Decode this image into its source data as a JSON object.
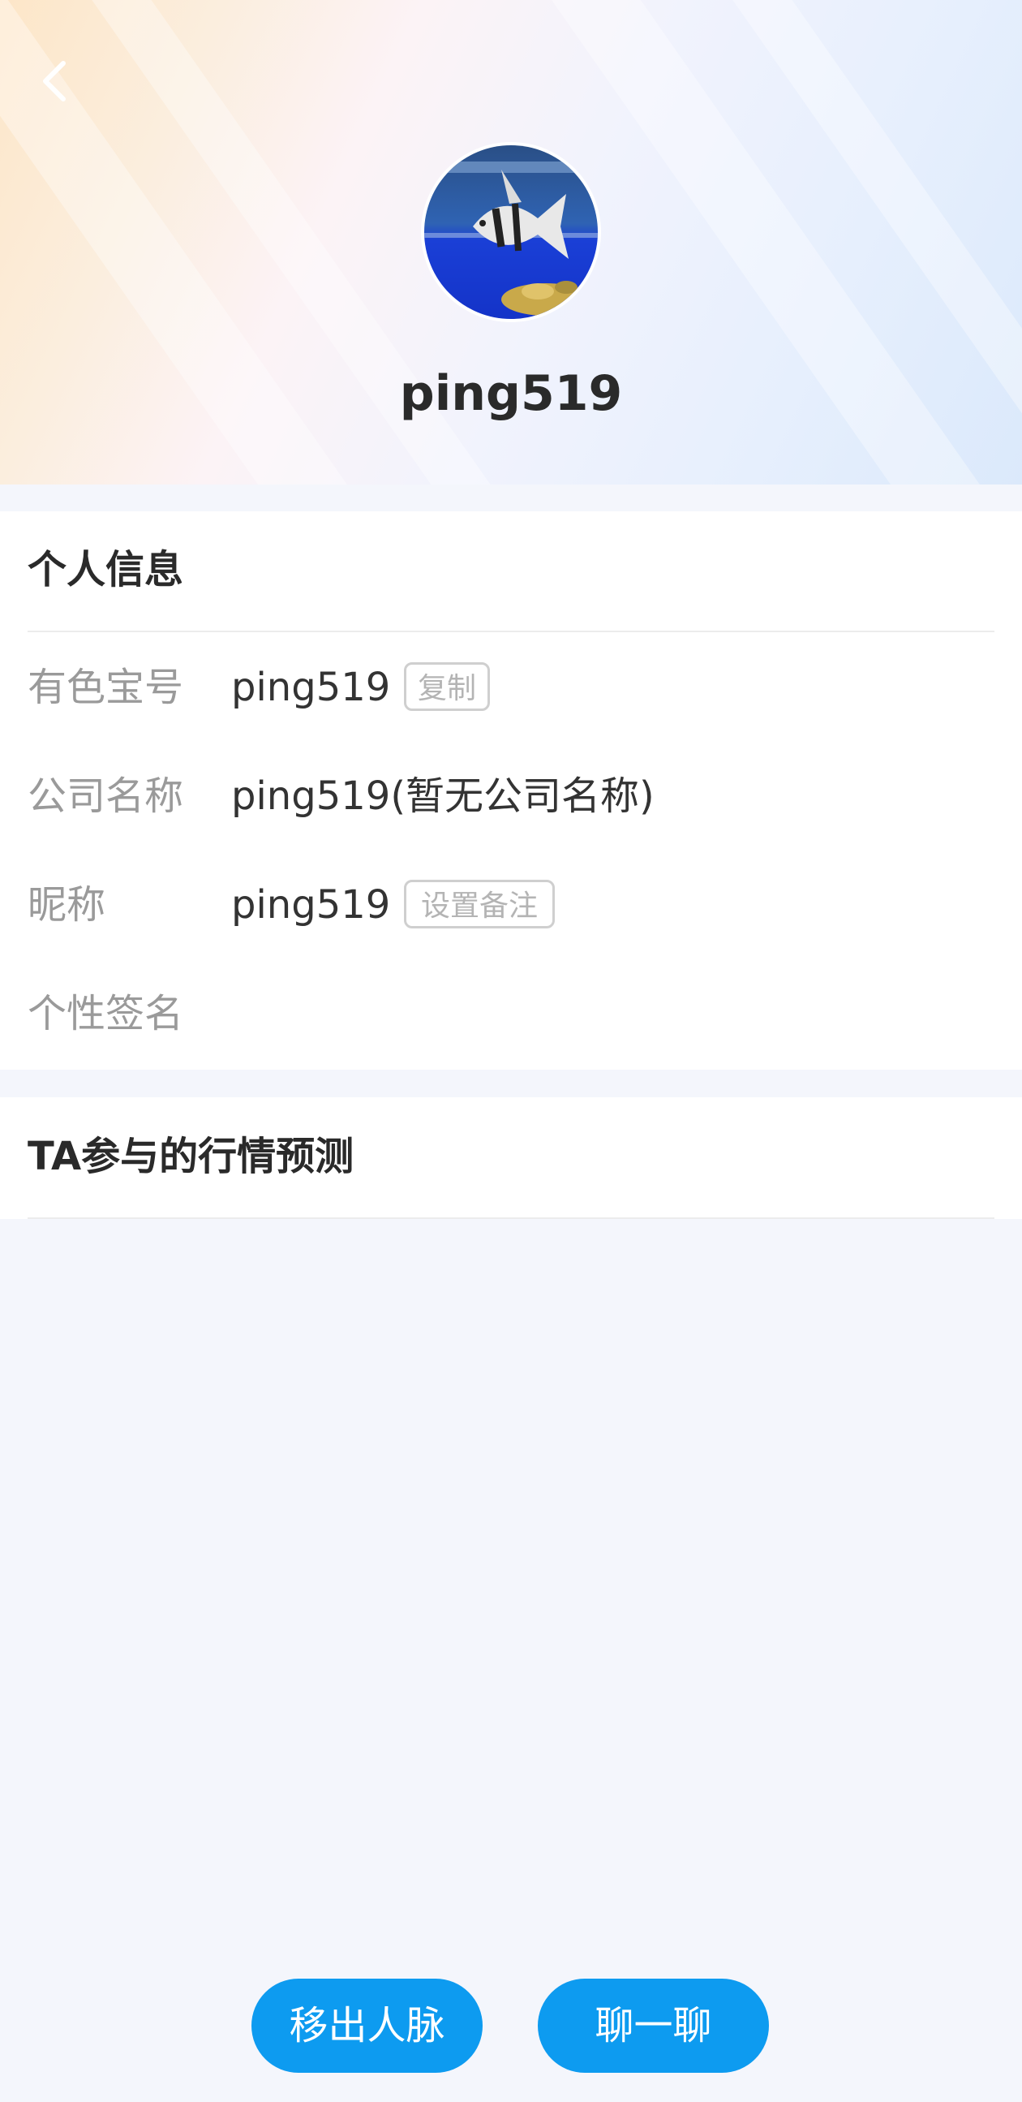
{
  "profile": {
    "username": "ping519"
  },
  "personal_info": {
    "title": "个人信息",
    "rows": [
      {
        "label": "有色宝号",
        "value": "ping519",
        "action": "复制"
      },
      {
        "label": "公司名称",
        "value": "ping519(暂无公司名称)"
      },
      {
        "label": "昵称",
        "value": "ping519",
        "action": "设置备注"
      },
      {
        "label": "个性签名",
        "value": ""
      }
    ]
  },
  "prediction": {
    "title": "TA参与的行情预测"
  },
  "actions": {
    "remove_label": "移出人脉",
    "chat_label": "聊一聊"
  },
  "colors": {
    "accent": "#0d9bf0",
    "background": "#f4f6fc"
  },
  "icons": {
    "back": "chevron-left-icon",
    "avatar": "fish-avatar-image"
  }
}
